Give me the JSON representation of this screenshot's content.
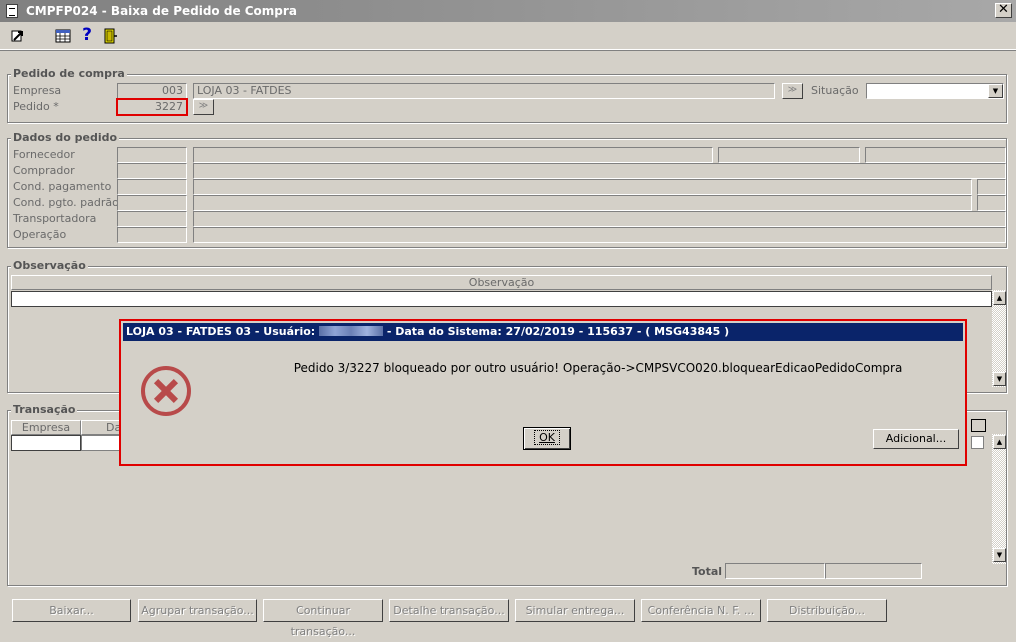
{
  "window": {
    "title": "CMPFP024 - Baixa de Pedido de Compra",
    "close_glyph": "✕"
  },
  "toolbar": {
    "icons": [
      "exit-arrow-icon",
      "calendar-grid-icon",
      "help-question-icon",
      "door-exit-icon"
    ],
    "help_glyph": "?"
  },
  "pedido_compra": {
    "title": "Pedido de compra",
    "empresa_label": "Empresa",
    "empresa_code": "003",
    "empresa_name": "LOJA 03 - FATDES",
    "pedido_label": "Pedido *",
    "pedido_value": "3227",
    "situacao_label": "Situação",
    "situacao_value": ""
  },
  "dados_pedido": {
    "title": "Dados do pedido",
    "labels": [
      "Fornecedor",
      "Comprador",
      "Cond. pagamento",
      "Cond. pgto. padrão",
      "Transportadora",
      "Operação"
    ]
  },
  "observacao": {
    "title": "Observação",
    "column_header": "Observação"
  },
  "transacao": {
    "title": "Transação",
    "col_empresa": "Empresa",
    "col_data": "Da",
    "total_label": "Total"
  },
  "buttons": {
    "baixar": "Baixar...",
    "agrupar": "Agrupar transação...",
    "continuar": "Continuar transação...",
    "detalhe": "Detalhe transação...",
    "simular": "Simular entrega...",
    "conferencia": "Conferência N. F. ...",
    "distribuicao": "Distribuição..."
  },
  "dialog": {
    "title_prefix": "LOJA 03 - FATDES 03 - Usuário:",
    "title_suffix": "- Data do Sistema: 27/02/2019 - 115637 - ( MSG43845 )",
    "message": "Pedido 3/3227 bloqueado por outro usuário! Operação->CMPSVCO020.bloquearEdicaoPedidoCompra",
    "ok_label": "OK",
    "adicional_label": "Adicional..."
  },
  "colors": {
    "dialog_title_bg": "#0a246a",
    "highlight_border": "#e00000",
    "error_icon": "#b84a4a",
    "window_bg": "#d4d0c8"
  }
}
